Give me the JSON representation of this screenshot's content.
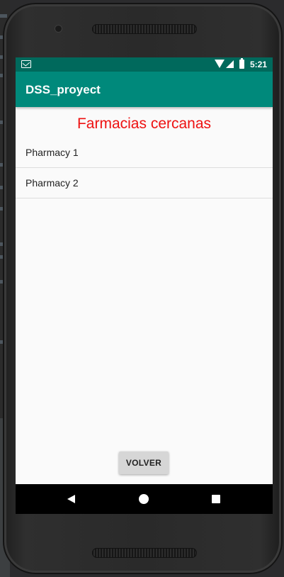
{
  "status_bar": {
    "time": "5:21",
    "icons": [
      "mail-icon",
      "wifi-icon",
      "signal-icon",
      "battery-icon"
    ]
  },
  "app_bar": {
    "title": "DSS_proyect",
    "color": "#00897b",
    "status_color": "#00695c"
  },
  "main": {
    "heading": "Farmacias cercanas",
    "heading_color": "#ee1111",
    "pharmacies": [
      {
        "label": "Pharmacy 1"
      },
      {
        "label": "Pharmacy 2"
      }
    ],
    "back_button_label": "VOLVER"
  },
  "navigation_bar": {
    "icons": [
      "back-icon",
      "home-icon",
      "recents-icon"
    ]
  }
}
